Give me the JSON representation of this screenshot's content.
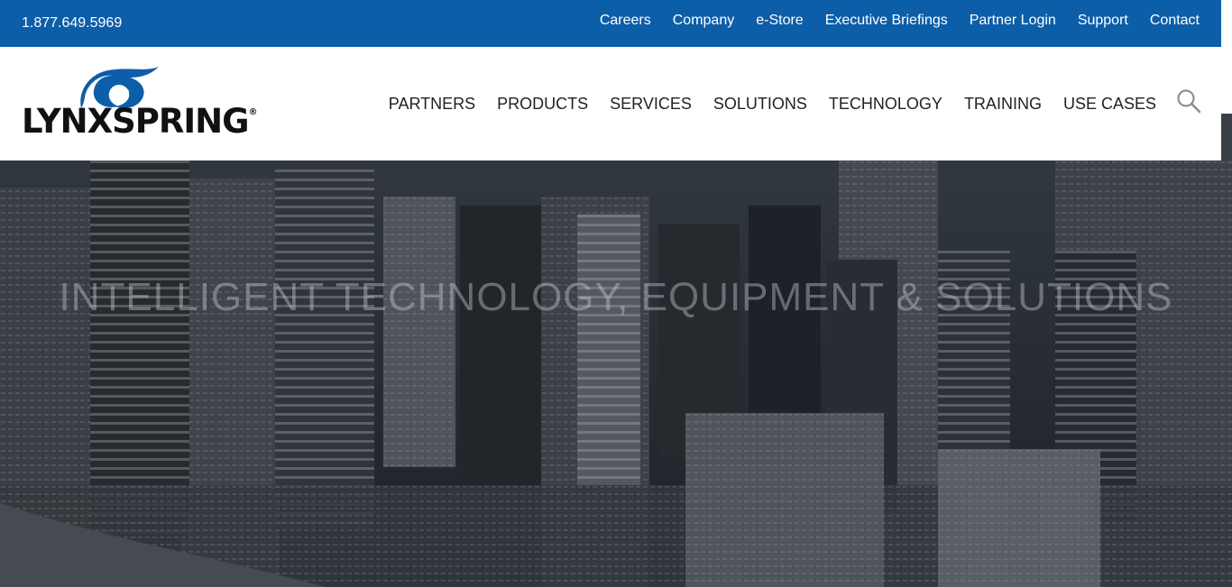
{
  "topbar": {
    "phone": "1.877.649.5969",
    "links": [
      "Careers",
      "Company",
      "e-Store",
      "Executive Briefings",
      "Partner Login",
      "Support",
      "Contact"
    ]
  },
  "header": {
    "logo_text": "LYNXSPRING",
    "logo_reg": "®",
    "nav": [
      "PARTNERS",
      "PRODUCTS",
      "SERVICES",
      "SOLUTIONS",
      "TECHNOLOGY",
      "TRAINING",
      "USE CASES"
    ],
    "search_icon": "search-icon"
  },
  "hero": {
    "title": "INTELLIGENT TECHNOLOGY, EQUIPMENT & SOLUTIONS"
  },
  "colors": {
    "topbar": "#0d5ea8",
    "logo_blue": "#0d5ea8",
    "hero_overlay": "#1e2329"
  }
}
